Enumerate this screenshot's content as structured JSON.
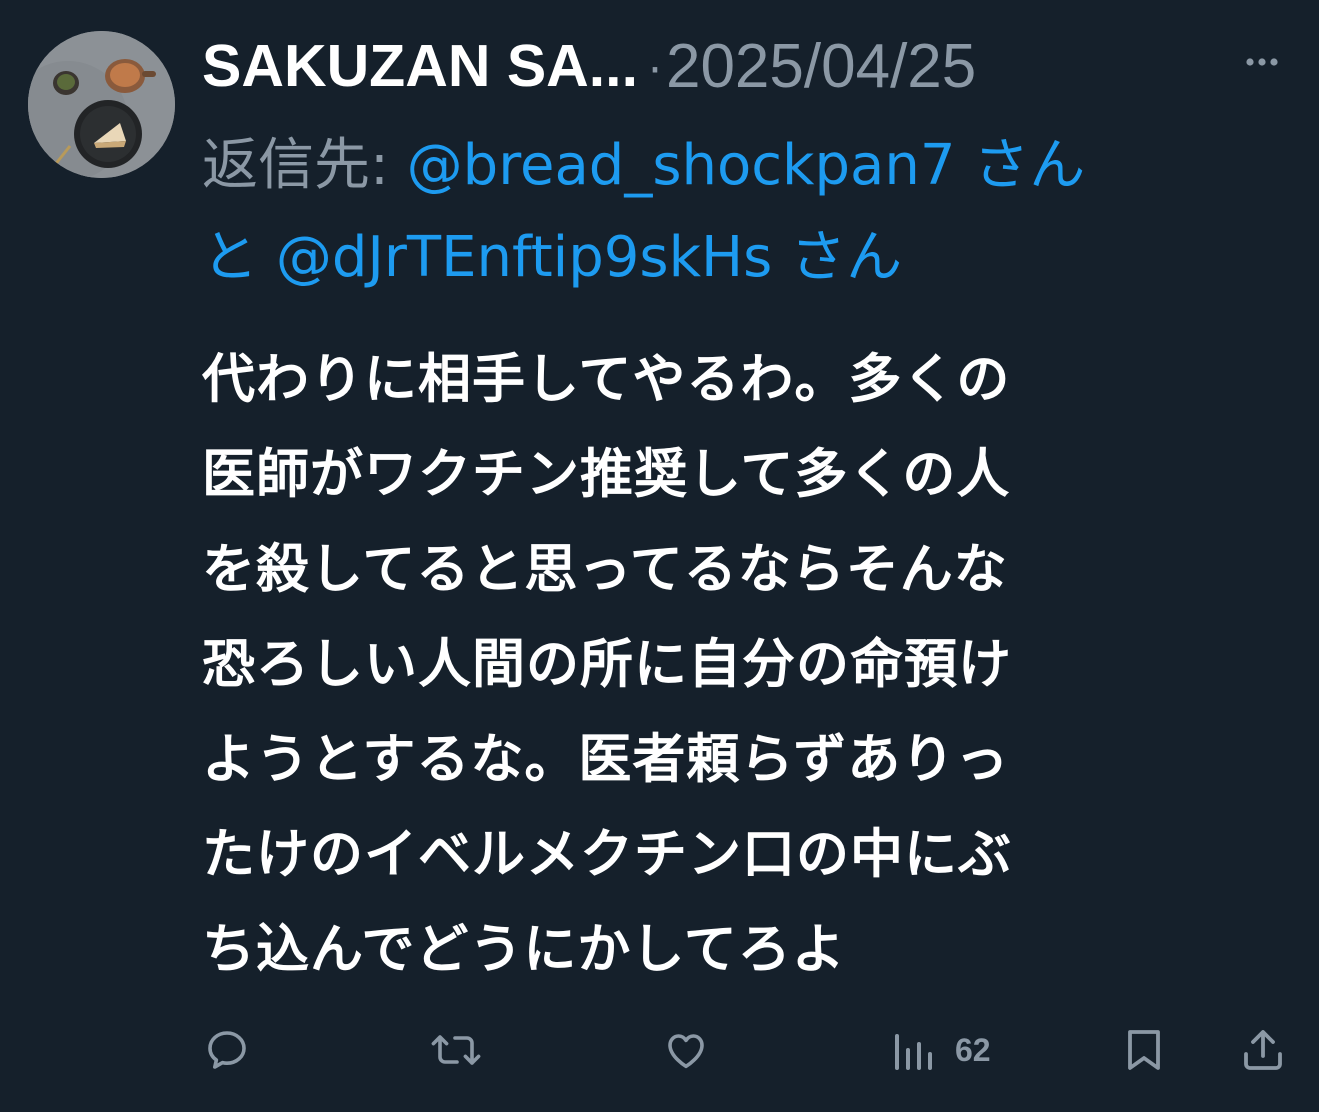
{
  "tweet": {
    "display_name": "SAKUZAN SA...",
    "separator": "·",
    "date": "2025/04/25",
    "reply_label": "返信先: ",
    "mention_1": "@bread_shockpan7 さん",
    "conjunction": "と ",
    "mention_2": "@dJrTEnftip9skHs さん",
    "text_lines": [
      "代わりに相手してやるわ。多くの",
      "医師がワクチン推奨して多くの人",
      "を殺してると思ってるならそんな",
      "恐ろしい人間の所に自分の命預け",
      "ようとするな。医者頼らずありっ",
      "たけのイベルメクチン口の中にぶ",
      "ち込んでどうにかしてろよ"
    ]
  },
  "actions": {
    "reply_icon": "reply-icon",
    "retweet_icon": "retweet-icon",
    "like_icon": "heart-icon",
    "views_icon": "analytics-icon",
    "views_count": "62",
    "bookmark_icon": "bookmark-icon",
    "share_icon": "share-icon"
  },
  "colors": {
    "background": "#15202b",
    "primary_text": "#ffffff",
    "secondary_text": "#8b98a5",
    "link": "#1d9bf0"
  }
}
